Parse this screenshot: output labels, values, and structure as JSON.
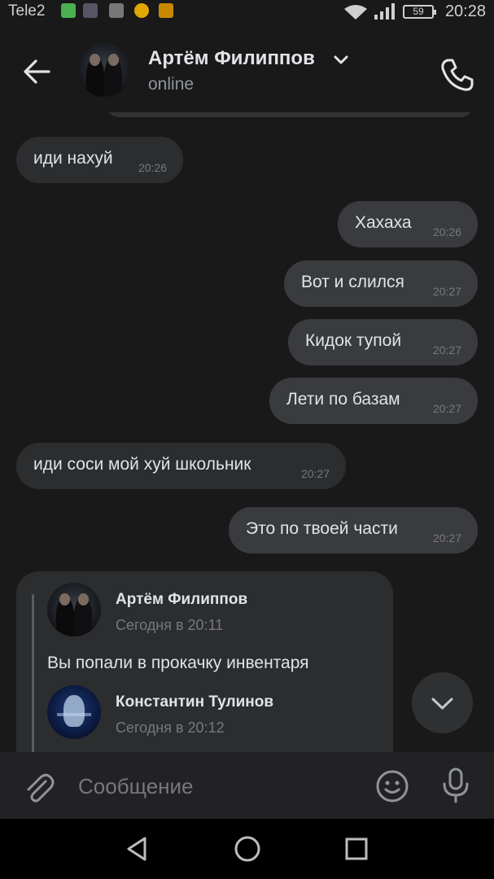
{
  "status_bar": {
    "carrier": "Tele2",
    "battery": "59",
    "time": "20:28"
  },
  "header": {
    "contact_name": "Артём Филиппов",
    "status": "online"
  },
  "messages": [
    {
      "direction": "in",
      "text": "иди нахуй",
      "time": "20:26"
    },
    {
      "direction": "out",
      "text": "Хахаха",
      "time": "20:26"
    },
    {
      "direction": "out",
      "text": "Вот и слился",
      "time": "20:27"
    },
    {
      "direction": "out",
      "text": "Кидок тупой",
      "time": "20:27"
    },
    {
      "direction": "out",
      "text": "Лети по базам",
      "time": "20:27"
    },
    {
      "direction": "in",
      "text": "иди соси мой хуй школьник",
      "time": "20:27"
    },
    {
      "direction": "out",
      "text": "Это по твоей части",
      "time": "20:27"
    }
  ],
  "forwarded": {
    "author1": "Артём Филиппов",
    "date1": "Сегодня в 20:11",
    "text1": "Вы попали в прокачку инвентаря",
    "author2": "Константин Тулинов",
    "date2": "Сегодня в 20:12"
  },
  "input": {
    "placeholder": "Сообщение"
  },
  "icons": {
    "back": "arrow-left-icon",
    "call": "phone-icon",
    "attach": "paperclip-icon",
    "emoji": "smiley-icon",
    "mic": "microphone-icon",
    "scroll": "chevron-down-icon"
  },
  "colors": {
    "background": "#19191a",
    "bubble_in": "#2c2d2f",
    "bubble_out": "#3a3b3e",
    "text": "#e1e3e6",
    "secondary_text": "#76787a"
  }
}
